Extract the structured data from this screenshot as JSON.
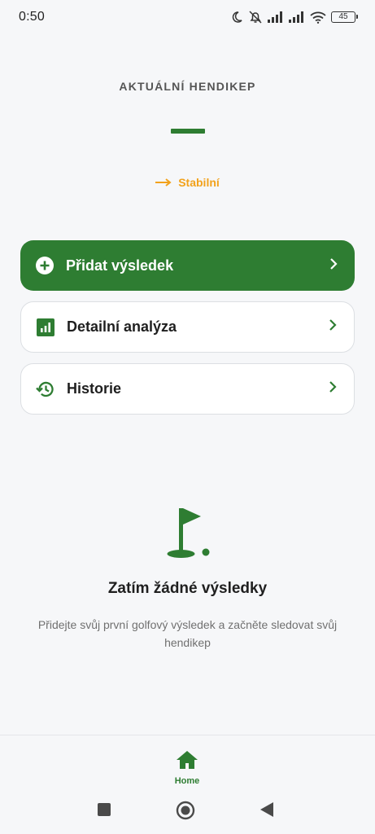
{
  "status_bar": {
    "time": "0:50",
    "battery": "45"
  },
  "handicap": {
    "label": "AKTUÁLNÍ HENDIKEP",
    "value": "—",
    "trend": "Stabilní",
    "trend_color": "#f2a21b"
  },
  "actions": {
    "add_result": "Přidat výsledek",
    "detailed_analysis": "Detailní analýza",
    "history": "Historie"
  },
  "empty_state": {
    "title": "Zatím žádné výsledky",
    "description": "Přidejte svůj první golfový výsledek a začněte sledovat svůj hendikep"
  },
  "bottom_nav": {
    "home_label": "Home"
  },
  "colors": {
    "accent": "#2e7d32",
    "background": "#f6f7f9"
  }
}
